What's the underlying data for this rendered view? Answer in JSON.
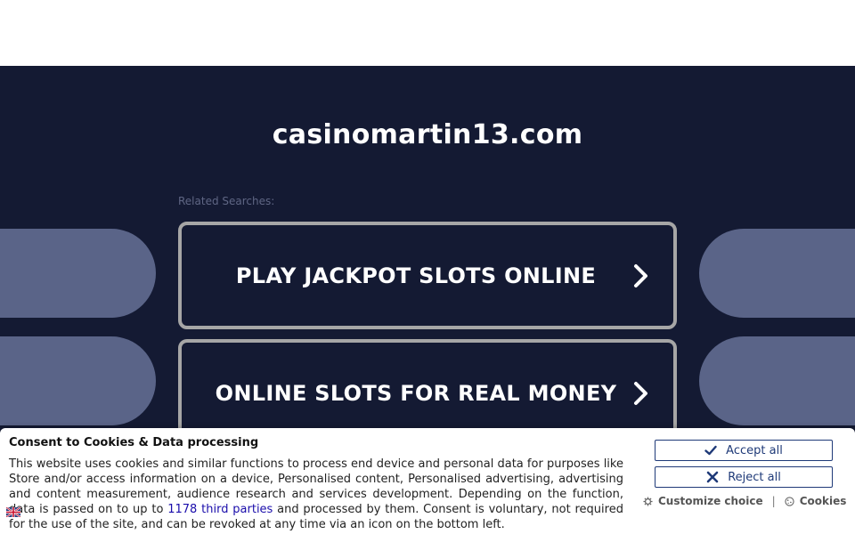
{
  "page": {
    "domain": "casinomartin13.com",
    "related_label": "Related Searches:"
  },
  "searches": [
    {
      "label": "PLAY JACKPOT SLOTS ONLINE",
      "icon": "chevron-right-icon"
    },
    {
      "label": "ONLINE SLOTS FOR REAL MONEY",
      "icon": "chevron-right-icon"
    }
  ],
  "consent": {
    "title": "Consent to Cookies & Data processing",
    "body_before": "This website uses cookies and similar functions to process end device and personal data for purposes like Store and/or access information on a device, Personalised content, Personalised advertising, advertising and content measurement, audience research and services development. Depending on the function, data is passed on to up to ",
    "link_text": "1178 third parties",
    "body_after": " and processed by them. Consent is voluntary, not required for the use of the site, and can be revoked at any time via an icon on the bottom left.",
    "accept_label": "Accept all",
    "reject_label": "Reject all",
    "customize_label": "Customize choice",
    "cookies_label": "Cookies",
    "separator": "|"
  },
  "colors": {
    "background": "#141a33",
    "card_border": "#a6a6a6",
    "side_pill": "#5a6488",
    "button_accent": "#1f3a78",
    "link": "#1a0dab"
  }
}
